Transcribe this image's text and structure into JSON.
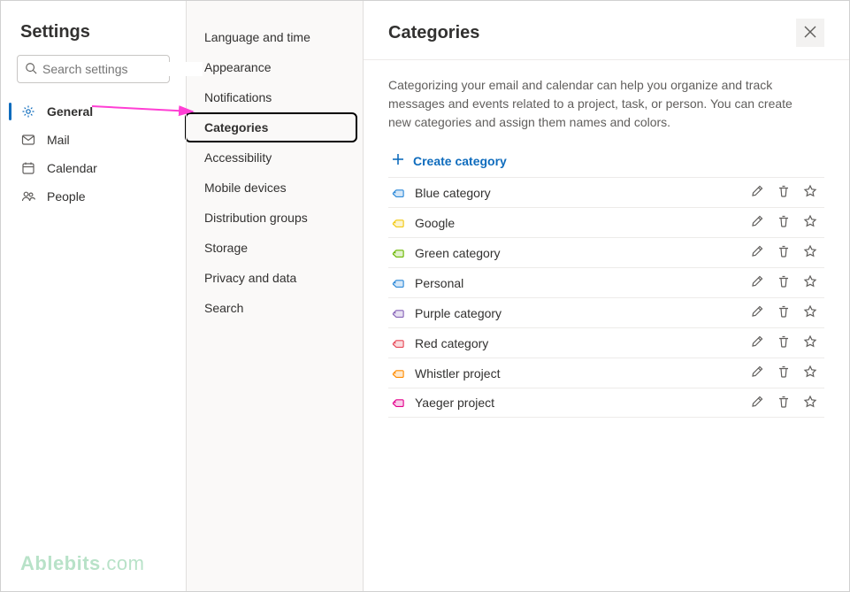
{
  "settings_title": "Settings",
  "search": {
    "placeholder": "Search settings"
  },
  "primary_nav": [
    {
      "id": "general",
      "label": "General",
      "icon": "gear",
      "active": true
    },
    {
      "id": "mail",
      "label": "Mail",
      "icon": "mail",
      "active": false
    },
    {
      "id": "calendar",
      "label": "Calendar",
      "icon": "calendar",
      "active": false
    },
    {
      "id": "people",
      "label": "People",
      "icon": "people",
      "active": false
    }
  ],
  "secondary_nav": [
    {
      "label": "Language and time",
      "selected": false
    },
    {
      "label": "Appearance",
      "selected": false
    },
    {
      "label": "Notifications",
      "selected": false
    },
    {
      "label": "Categories",
      "selected": true
    },
    {
      "label": "Accessibility",
      "selected": false
    },
    {
      "label": "Mobile devices",
      "selected": false
    },
    {
      "label": "Distribution groups",
      "selected": false
    },
    {
      "label": "Storage",
      "selected": false
    },
    {
      "label": "Privacy and data",
      "selected": false
    },
    {
      "label": "Search",
      "selected": false
    }
  ],
  "content": {
    "title": "Categories",
    "description": "Categorizing your email and calendar can help you organize and track messages and events related to a project, task, or person. You can create new categories and assign them names and colors.",
    "create_label": "Create category"
  },
  "categories": [
    {
      "label": "Blue category",
      "color": "#2b88d8"
    },
    {
      "label": "Google",
      "color": "#f2c811"
    },
    {
      "label": "Green category",
      "color": "#6bb700"
    },
    {
      "label": "Personal",
      "color": "#2b88d8"
    },
    {
      "label": "Purple category",
      "color": "#8764b8"
    },
    {
      "label": "Red category",
      "color": "#e74856"
    },
    {
      "label": "Whistler project",
      "color": "#ff8c00"
    },
    {
      "label": "Yaeger project",
      "color": "#e3008c"
    }
  ],
  "watermark": {
    "brand": "Ablebits",
    "domain": ".com"
  }
}
